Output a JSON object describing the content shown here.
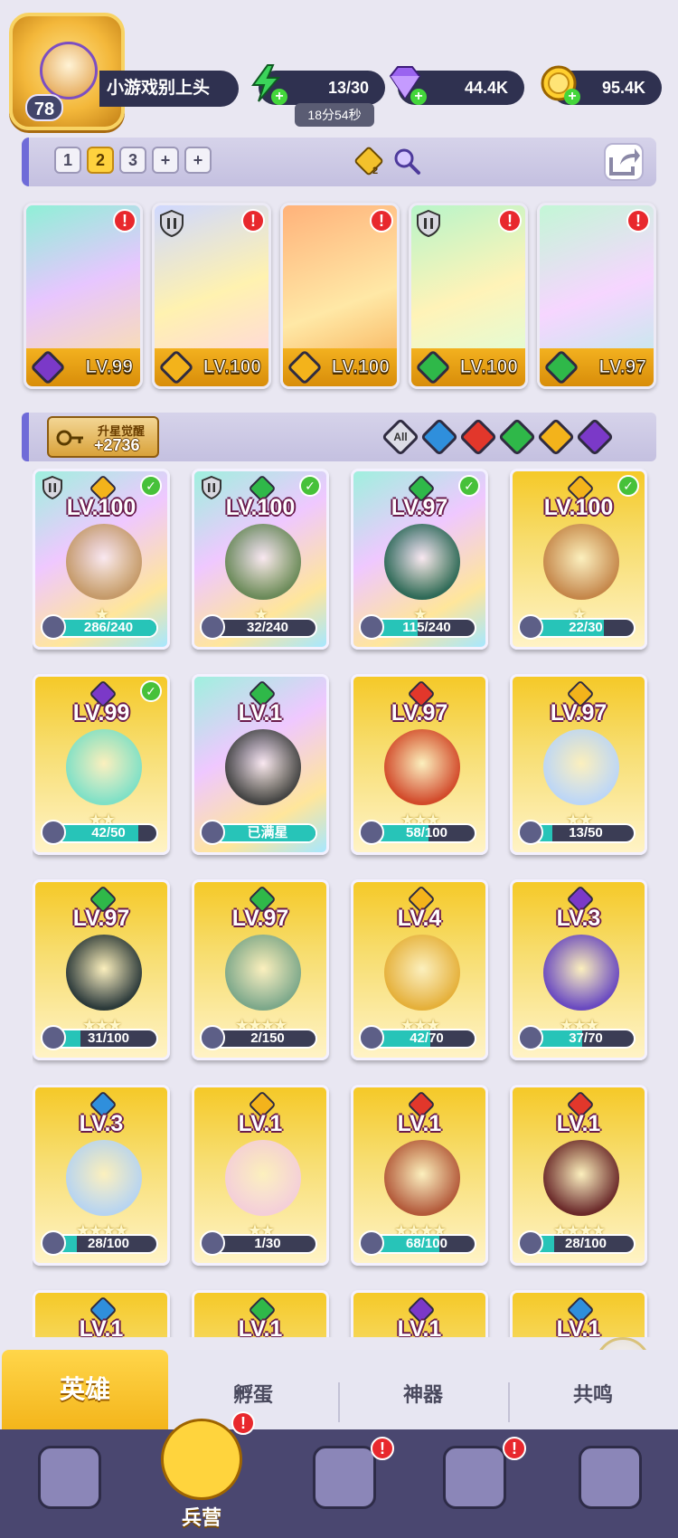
{
  "player": {
    "level": "78",
    "name": "小游戏别上头"
  },
  "resources": {
    "stamina": "13/30",
    "stamina_timer": "18分54秒",
    "gems": "44.4K",
    "gold": "95.4K"
  },
  "team_tabs": [
    "1",
    "2",
    "3",
    "+",
    "+"
  ],
  "team_tab_active": "2",
  "team_badge": "2",
  "lineup": [
    {
      "level": "LV.99",
      "element": "dark",
      "alert": "!"
    },
    {
      "level": "LV.100",
      "element": "light",
      "alert": "!"
    },
    {
      "level": "LV.100",
      "element": "light",
      "alert": "!"
    },
    {
      "level": "LV.100",
      "element": "nature",
      "alert": "!"
    },
    {
      "level": "LV.97",
      "element": "nature",
      "alert": "!"
    }
  ],
  "awaken": {
    "title": "升星觉醒",
    "value": "+2736"
  },
  "filters": [
    {
      "name": "all",
      "label": "All",
      "color": "#dcdce6"
    },
    {
      "name": "water",
      "label": "",
      "color": "#2f8fdc"
    },
    {
      "name": "fire",
      "label": "",
      "color": "#e2372b"
    },
    {
      "name": "nature",
      "label": "",
      "color": "#2fb849"
    },
    {
      "name": "light",
      "label": "",
      "color": "#f3b31b"
    },
    {
      "name": "dark",
      "label": "",
      "color": "#7b39c8"
    }
  ],
  "heroes": [
    {
      "level": "LV.100",
      "progress": "286/240",
      "fill": 1.0,
      "stars": "★",
      "element": "light",
      "check": true,
      "shield": true,
      "theme": "rainbow"
    },
    {
      "level": "LV.100",
      "progress": "32/240",
      "fill": 0.13,
      "stars": "★",
      "element": "nature",
      "check": true,
      "shield": true,
      "theme": "rainbow"
    },
    {
      "level": "LV.97",
      "progress": "115/240",
      "fill": 0.48,
      "stars": "★",
      "element": "nature",
      "check": true,
      "shield": false,
      "theme": "rainbow"
    },
    {
      "level": "LV.100",
      "progress": "22/30",
      "fill": 0.73,
      "stars": "★",
      "element": "light",
      "check": true,
      "shield": false,
      "theme": "gold"
    },
    {
      "level": "LV.99",
      "progress": "42/50",
      "fill": 0.84,
      "stars": "★★",
      "element": "dark",
      "check": true,
      "shield": false,
      "theme": "gold"
    },
    {
      "level": "LV.1",
      "progress": "已满星",
      "fill": 1.0,
      "stars": "",
      "element": "nature",
      "check": false,
      "shield": false,
      "theme": "rainbow"
    },
    {
      "level": "LV.97",
      "progress": "58/100",
      "fill": 0.58,
      "stars": "★★★",
      "element": "fire",
      "check": false,
      "shield": false,
      "theme": "gold"
    },
    {
      "level": "LV.97",
      "progress": "13/50",
      "fill": 0.26,
      "stars": "★★",
      "element": "light",
      "check": false,
      "shield": false,
      "theme": "gold"
    },
    {
      "level": "LV.97",
      "progress": "31/100",
      "fill": 0.31,
      "stars": "★★★",
      "element": "nature",
      "check": false,
      "shield": false,
      "theme": "gold"
    },
    {
      "level": "LV.97",
      "progress": "2/150",
      "fill": 0.01,
      "stars": "★★★★",
      "element": "nature",
      "check": false,
      "shield": false,
      "theme": "gold"
    },
    {
      "level": "LV.4",
      "progress": "42/70",
      "fill": 0.6,
      "stars": "★★★",
      "element": "light",
      "check": false,
      "shield": false,
      "theme": "gold"
    },
    {
      "level": "LV.3",
      "progress": "37/70",
      "fill": 0.53,
      "stars": "★★★",
      "element": "dark",
      "check": false,
      "shield": false,
      "theme": "gold"
    },
    {
      "level": "LV.3",
      "progress": "28/100",
      "fill": 0.28,
      "stars": "★★★★",
      "element": "water",
      "check": false,
      "shield": false,
      "theme": "gold"
    },
    {
      "level": "LV.1",
      "progress": "1/30",
      "fill": 0.03,
      "stars": "★★",
      "element": "light",
      "check": false,
      "shield": false,
      "theme": "gold"
    },
    {
      "level": "LV.1",
      "progress": "68/100",
      "fill": 0.68,
      "stars": "★★★★",
      "element": "fire",
      "check": false,
      "shield": false,
      "theme": "gold"
    },
    {
      "level": "LV.1",
      "progress": "28/100",
      "fill": 0.28,
      "stars": "★★★★",
      "element": "fire",
      "check": false,
      "shield": false,
      "theme": "gold"
    },
    {
      "level": "LV.1",
      "progress": "",
      "fill": 0,
      "stars": "",
      "element": "water",
      "check": false,
      "shield": false,
      "theme": "gold"
    },
    {
      "level": "LV.1",
      "progress": "",
      "fill": 0,
      "stars": "",
      "element": "nature",
      "check": false,
      "shield": false,
      "theme": "gold"
    },
    {
      "level": "LV.1",
      "progress": "",
      "fill": 0,
      "stars": "",
      "element": "dark",
      "check": false,
      "shield": false,
      "theme": "gold"
    },
    {
      "level": "LV.1",
      "progress": "",
      "fill": 0,
      "stars": "",
      "element": "water",
      "check": false,
      "shield": false,
      "theme": "gold"
    }
  ],
  "element_colors": {
    "light": "#f3b31b",
    "nature": "#2fb849",
    "dark": "#7b39c8",
    "fire": "#e2372b",
    "water": "#2f8fdc"
  },
  "section_tabs": [
    "英雄",
    "孵蛋",
    "神器",
    "共鸣"
  ],
  "section_active": "英雄",
  "bottom_nav": [
    {
      "name": "cards",
      "label": ""
    },
    {
      "name": "barracks",
      "label": "兵营",
      "alert": "!"
    },
    {
      "name": "map",
      "label": "",
      "alert": "!"
    },
    {
      "name": "temple",
      "label": "",
      "alert": "!"
    },
    {
      "name": "guild",
      "label": ""
    }
  ],
  "side_alert": "!"
}
